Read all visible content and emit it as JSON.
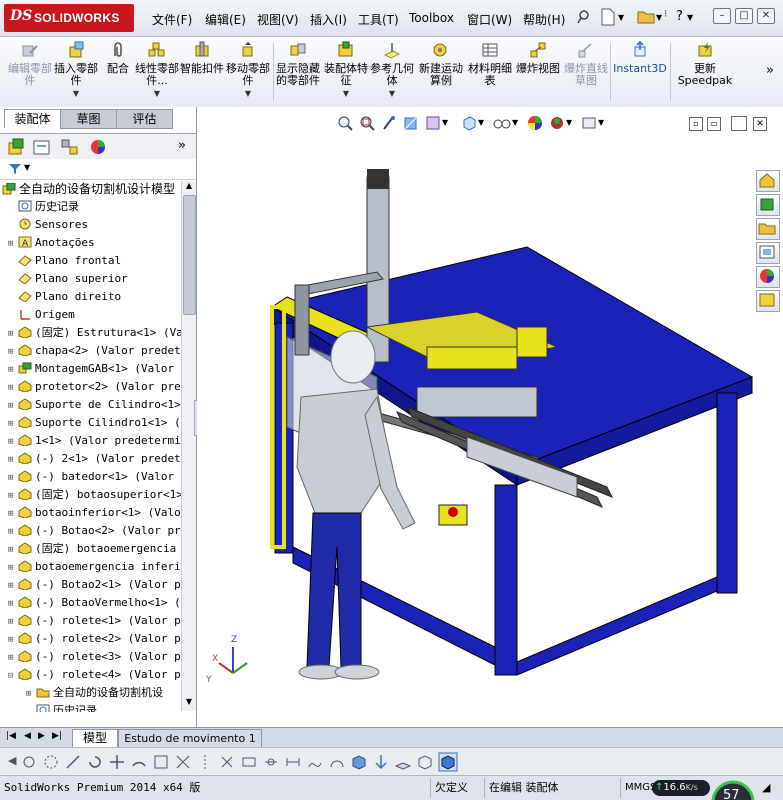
{
  "app": {
    "logo_ds": "DS",
    "logo_name": "SOLIDWORKS"
  },
  "menu": [
    "文件(F)",
    "编辑(E)",
    "视图(V)",
    "插入(I)",
    "工具(T)",
    "Toolbox",
    "窗口(W)",
    "帮助(H)"
  ],
  "window_buttons": [
    "?",
    "–",
    "□",
    "✕"
  ],
  "commands": [
    {
      "label": "编辑零部件",
      "disabled": true,
      "dropdown": false
    },
    {
      "label": "插入零部件",
      "disabled": false,
      "dropdown": true
    },
    {
      "label": "配合",
      "disabled": false,
      "dropdown": false
    },
    {
      "label": "线性零部件...",
      "disabled": false,
      "dropdown": true
    },
    {
      "label": "智能扣件",
      "disabled": false,
      "dropdown": false
    },
    {
      "label": "移动零部件",
      "disabled": false,
      "dropdown": true
    },
    {
      "label": "显示隐藏的零部件",
      "disabled": false,
      "dropdown": false
    },
    {
      "label": "装配体特征",
      "disabled": false,
      "dropdown": true
    },
    {
      "label": "参考几何体",
      "disabled": false,
      "dropdown": true
    },
    {
      "label": "新建运动算例",
      "disabled": false,
      "dropdown": false
    },
    {
      "label": "材料明细表",
      "disabled": false,
      "dropdown": false
    },
    {
      "label": "爆炸视图",
      "disabled": false,
      "dropdown": false
    },
    {
      "label": "爆炸直线草图",
      "disabled": true,
      "dropdown": false
    },
    {
      "label": "Instant3D",
      "disabled": false,
      "dropdown": false
    },
    {
      "label": "更新Speedpak",
      "disabled": false,
      "dropdown": false
    }
  ],
  "more_commands": "»",
  "panel_tabs": [
    "装配体",
    "草图",
    "评估"
  ],
  "panel_more": "»",
  "tree": {
    "root": "全自动的设备切割机设计模型",
    "items": [
      {
        "label": "历史记录",
        "expand": "",
        "kind": "history"
      },
      {
        "label": "Sensores",
        "expand": "",
        "kind": "sensor"
      },
      {
        "label": "Anotações",
        "expand": "+",
        "kind": "annot"
      },
      {
        "label": "Plano frontal",
        "expand": "",
        "kind": "plane"
      },
      {
        "label": "Plano superior",
        "expand": "",
        "kind": "plane"
      },
      {
        "label": "Plano direito",
        "expand": "",
        "kind": "plane"
      },
      {
        "label": "Origem",
        "expand": "",
        "kind": "origin"
      },
      {
        "label": "(固定) Estrutura<1> (Va",
        "expand": "+",
        "kind": "part"
      },
      {
        "label": "chapa<2> (Valor predete",
        "expand": "+",
        "kind": "part"
      },
      {
        "label": "MontagemGAB<1> (Valor p",
        "expand": "+",
        "kind": "asm"
      },
      {
        "label": "protetor<2> (Valor pred",
        "expand": "+",
        "kind": "part"
      },
      {
        "label": "Suporte de Cilindro<1>",
        "expand": "+",
        "kind": "part"
      },
      {
        "label": "Suporte Cilindro1<1> (V",
        "expand": "+",
        "kind": "part"
      },
      {
        "label": "1<1> (Valor predetermin",
        "expand": "+",
        "kind": "part"
      },
      {
        "label": "(-) 2<1> (Valor predete",
        "expand": "+",
        "kind": "part"
      },
      {
        "label": "(-) batedor<1> (Valor p",
        "expand": "+",
        "kind": "part"
      },
      {
        "label": "(固定) botaosuperior<1>",
        "expand": "+",
        "kind": "part"
      },
      {
        "label": "botaoinferior<1> (Valor",
        "expand": "+",
        "kind": "part"
      },
      {
        "label": "(-) Botao<2> (Valor pre",
        "expand": "+",
        "kind": "part"
      },
      {
        "label": "(固定) botaoemergencia",
        "expand": "+",
        "kind": "part"
      },
      {
        "label": "botaoemergencia inferic",
        "expand": "+",
        "kind": "part"
      },
      {
        "label": "(-) Botao2<1> (Valor pr",
        "expand": "+",
        "kind": "part"
      },
      {
        "label": "(-) BotaoVermelho<1> (V",
        "expand": "+",
        "kind": "part"
      },
      {
        "label": "(-) rolete<1> (Valor pr",
        "expand": "+",
        "kind": "part"
      },
      {
        "label": "(-) rolete<2> (Valor pr",
        "expand": "+",
        "kind": "part"
      },
      {
        "label": "(-) rolete<3> (Valor pr",
        "expand": "+",
        "kind": "part"
      },
      {
        "label": "(-) rolete<4> (Valor pr",
        "expand": "-",
        "kind": "part"
      },
      {
        "label": "全自动的设备切割机设",
        "expand": "+",
        "kind": "folder"
      },
      {
        "label": "历史记录",
        "expand": "",
        "kind": "history"
      }
    ]
  },
  "bottom_tabs": [
    "模型",
    "Estudo de movimento 1"
  ],
  "status": {
    "product": "SolidWorks Premium 2014 x64 版",
    "undefined": "欠定义",
    "editing": "在编辑 装配体",
    "units": "MMGS",
    "speed": "16.6",
    "speed_unit": "K/s",
    "gauge": "57"
  },
  "triad": {
    "z": "Z",
    "x": "X",
    "y": "Y"
  },
  "colors": {
    "frame_blue": "#1a22b8",
    "yellow": "#e8e21c",
    "brand_red": "#c8161d"
  }
}
